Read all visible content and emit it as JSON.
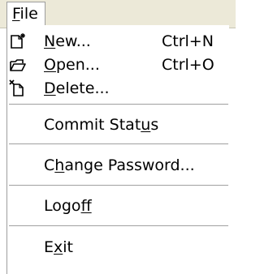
{
  "menubar": {
    "file_menu": {
      "pre": "",
      "mnemonic": "F",
      "post": "ile"
    }
  },
  "menu": {
    "items": [
      {
        "pre": "",
        "mnemonic": "N",
        "post": "ew...",
        "shortcut": "Ctrl+N",
        "icon": "new-document-icon"
      },
      {
        "pre": "",
        "mnemonic": "O",
        "post": "pen...",
        "shortcut": "Ctrl+O",
        "icon": "open-folder-icon"
      },
      {
        "pre": "",
        "mnemonic": "D",
        "post": "elete...",
        "shortcut": "",
        "icon": "delete-document-icon"
      },
      {
        "pre": "Commit Stat",
        "mnemonic": "u",
        "post": "s",
        "shortcut": ""
      },
      {
        "pre": "C",
        "mnemonic": "h",
        "post": "ange Password...",
        "shortcut": ""
      },
      {
        "pre": "Logo",
        "mnemonic": "f",
        "post": "f",
        "shortcut": ""
      },
      {
        "pre": "E",
        "mnemonic": "x",
        "post": "it",
        "shortcut": ""
      }
    ]
  }
}
